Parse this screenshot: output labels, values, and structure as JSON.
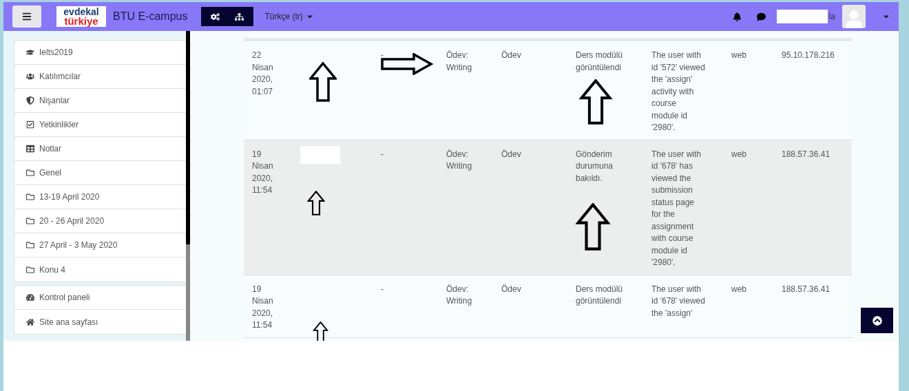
{
  "navbar": {
    "logo_top": "evdekal",
    "logo_bottom": "türkiye",
    "brand": "BTU E-campus",
    "language": "Türkçe (tr)",
    "user_name_fragment": "la"
  },
  "sidebar": {
    "groups": [
      {
        "items": [
          {
            "label": "Ielts2019",
            "kind": "course"
          },
          {
            "label": "Katılımcılar",
            "kind": "participants"
          },
          {
            "label": "Nişanlar",
            "kind": "badges"
          },
          {
            "label": "Yetkinlikler",
            "kind": "competencies"
          },
          {
            "label": "Notlar",
            "kind": "grades"
          },
          {
            "label": "Genel",
            "kind": "section"
          },
          {
            "label": "13-19 April 2020",
            "kind": "section"
          },
          {
            "label": "20 - 26 April 2020",
            "kind": "section"
          },
          {
            "label": "27 April - 3 May 2020",
            "kind": "section"
          },
          {
            "label": "Konu 4",
            "kind": "section"
          }
        ]
      },
      {
        "items": [
          {
            "label": "Kontrol paneli",
            "kind": "dashboard"
          },
          {
            "label": "Site ana sayfası",
            "kind": "home"
          }
        ]
      }
    ]
  },
  "log_table": {
    "rows": [
      {
        "shaded": false,
        "time": "22 Nisan 2020, 01:07",
        "affected_user": "-",
        "context": "Ödev: Writing",
        "component": "Ödev",
        "event": "Ders modülü görüntülendi",
        "description": "The user with id '572' viewed the 'assign' activity with course module id '2980'.",
        "origin": "web",
        "ip": "95.10.178.216"
      },
      {
        "shaded": true,
        "time": "19 Nisan 2020, 11:54",
        "affected_user": "-",
        "context": "Ödev: Writing",
        "component": "Ödev",
        "event": "Gönderim durumuna bakıldı.",
        "description": "The user with id '678' has viewed the submission status page for the assignment with course module id '2980'.",
        "origin": "web",
        "ip": "188.57.36.41"
      },
      {
        "shaded": false,
        "time": "19 Nisan 2020, 11:54",
        "affected_user": "-",
        "context": "Ödev: Writing",
        "component": "Ödev",
        "event": "Ders modülü görüntülendi",
        "description": "The user with id '678' viewed the 'assign'",
        "origin": "web",
        "ip": "188.57.36.41"
      }
    ]
  }
}
